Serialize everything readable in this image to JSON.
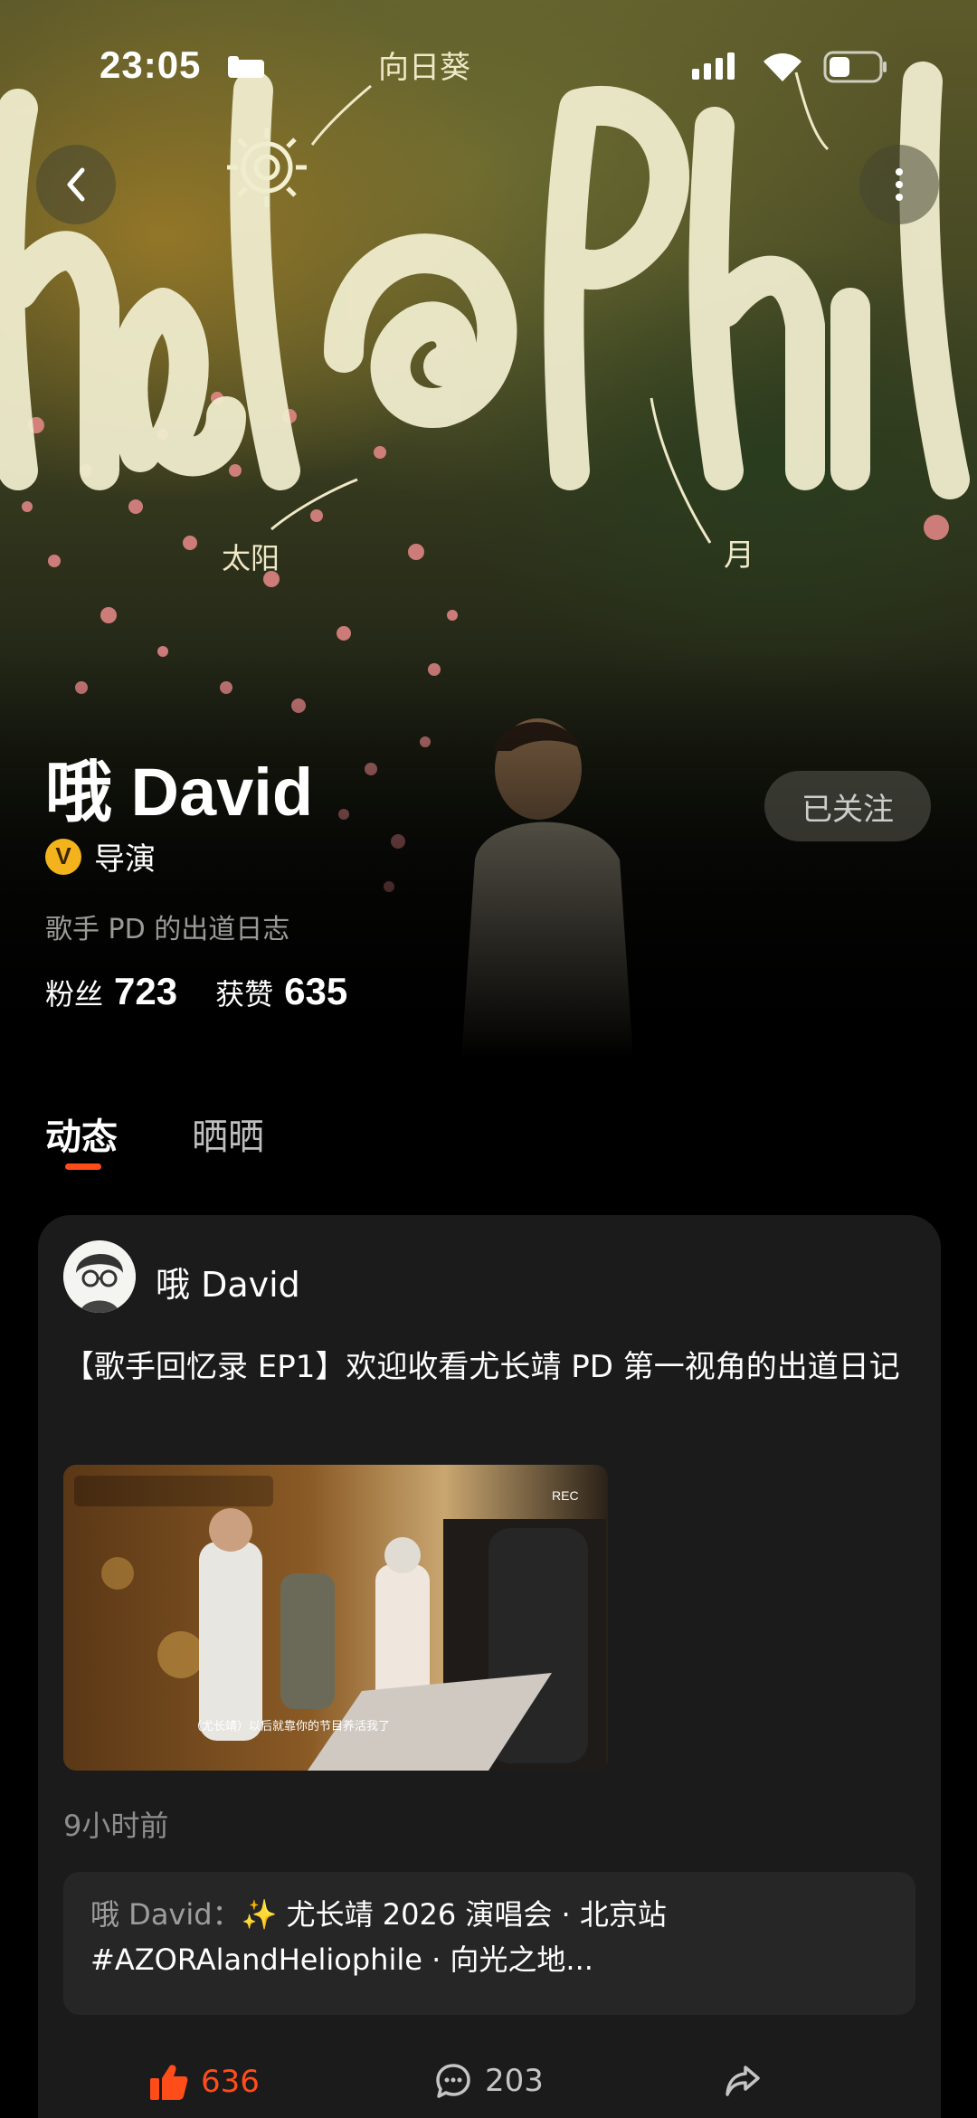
{
  "status_bar": {
    "time": "23:05"
  },
  "banner": {
    "art_labels": {
      "sunflower": "向日葵",
      "sun": "太阳",
      "moon": "月"
    }
  },
  "profile": {
    "name": "哦 David",
    "badge": "V",
    "role": "导演",
    "bio": "歌手 PD 的出道日志",
    "followers_label": "粉丝",
    "followers": "723",
    "likes_label": "获赞",
    "likes": "635",
    "follow_button": "已关注"
  },
  "tabs": [
    {
      "label": "动态",
      "active": true
    },
    {
      "label": "晒晒",
      "active": false
    }
  ],
  "post": {
    "author": "哦 David",
    "text": "【歌手回忆录 EP1】欢迎收看尤长靖 PD 第一视角的出道日记",
    "video_caption": "（尤长靖）以后就靠你的节目养活我了",
    "video_rec": "REC",
    "time": "9小时前",
    "quote_author": "哦 David：",
    "quote_text": "✨ 尤长靖 2026 演唱会 · 北京站 #AZORAlandHeliophile · 向光之地...",
    "likes": "636",
    "comments": "203"
  },
  "colors": {
    "accent": "#ff4d1a",
    "badge": "#f2b31c",
    "card": "#1b1b1c"
  }
}
